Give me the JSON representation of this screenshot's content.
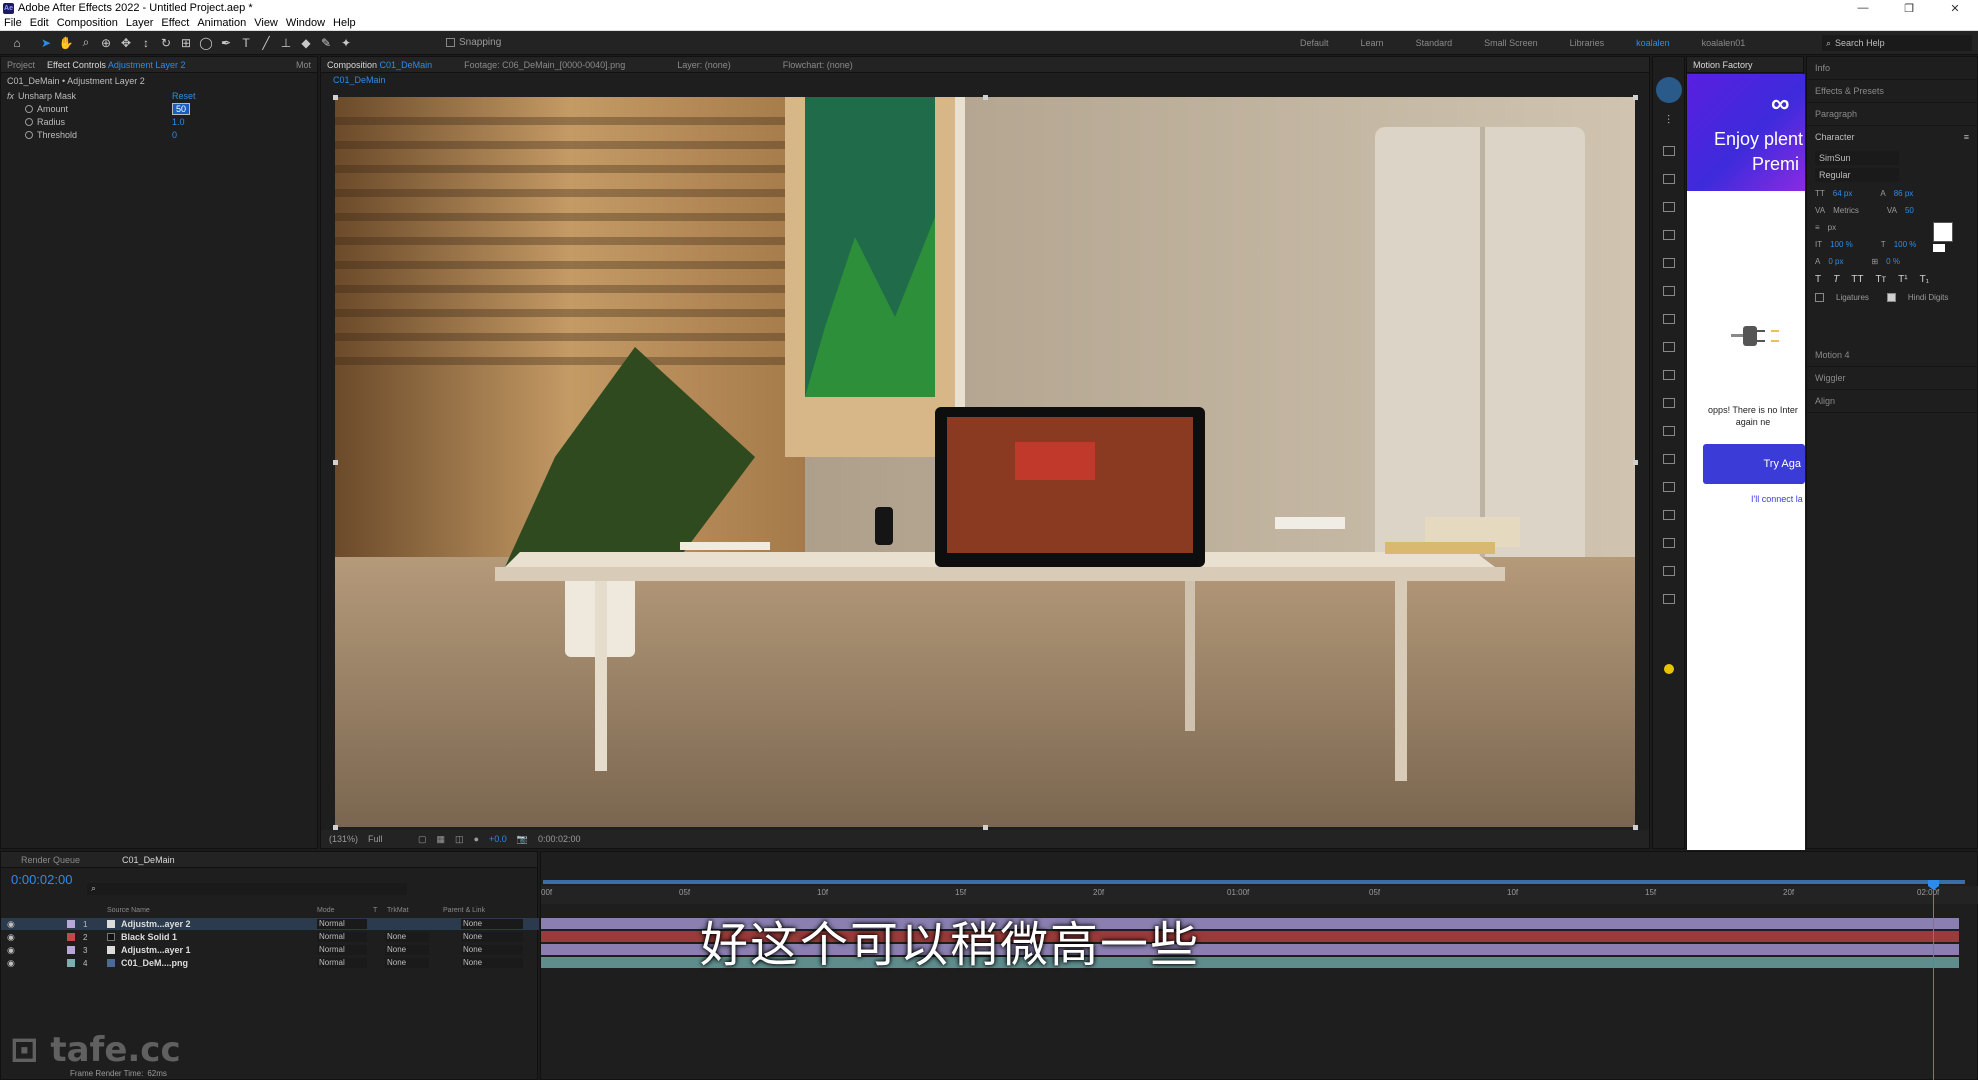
{
  "window": {
    "title": "Adobe After Effects 2022 - Untitled Project.aep *",
    "app_icon": "Ae",
    "controls": [
      "—",
      "❐",
      "✕"
    ]
  },
  "menu": [
    "File",
    "Edit",
    "Composition",
    "Layer",
    "Effect",
    "Animation",
    "View",
    "Window",
    "Help"
  ],
  "toolbar": {
    "snapping": "Snapping",
    "workspaces": [
      "Default",
      "Learn",
      "Standard",
      "Small Screen",
      "Libraries",
      "koalalen",
      "koalalen01"
    ],
    "active_workspace": "koalalen",
    "search_help": "Search Help"
  },
  "effect_controls": {
    "tabs": [
      "Project",
      "Effect Controls",
      "Mot"
    ],
    "active_layer": "Adjustment Layer 2",
    "subtitle": "C01_DeMain • Adjustment Layer 2",
    "effect_name": "Unsharp Mask",
    "reset_label": "Reset",
    "params": [
      {
        "label": "Amount",
        "value": "50"
      },
      {
        "label": "Radius",
        "value": "1.0"
      },
      {
        "label": "Threshold",
        "value": "0"
      }
    ]
  },
  "composition": {
    "tab_label": "Composition",
    "comp_name": "C01_DeMain",
    "footage_tab": "Footage: C06_DeMain_[0000-0040].png",
    "layer_tab": "Layer: (none)",
    "flowchart_tab": "Flowchart: (none)",
    "breadcrumb": "C01_DeMain",
    "zoom": "(131%)",
    "resolution": "Full",
    "exposure": "+0.0",
    "timecode": "0:00:02:00"
  },
  "motion_factory": {
    "tab": "Motion Factory",
    "banner_line1": "Enjoy plent",
    "banner_line2": "Premi",
    "message_line1": "opps! There is no Inter",
    "message_line2": "again ne",
    "button": "Try Aga",
    "link": "I'll connect la"
  },
  "right_panel": {
    "sections_top": [
      "Info",
      "Effects & Presets",
      "Paragraph"
    ],
    "character_title": "Character",
    "font": "SimSun",
    "style": "Regular",
    "size": "64 px",
    "leading": "86 px",
    "tracking": "50",
    "kerning": "Metrics",
    "unit": "px",
    "vscale": "100 %",
    "hscale": "100 %",
    "baseline": "0 px",
    "tsume": "0 %",
    "ligatures": "Ligatures",
    "hindi_digits": "Hindi Digits",
    "sections_bottom": [
      "Motion 4",
      "Wiggler",
      "Align"
    ]
  },
  "timeline": {
    "render_queue_tab": "Render Queue",
    "comp_tab": "C01_DeMain",
    "timecode": "0:00:02:00",
    "columns": [
      "Source Name",
      "Mode",
      "T",
      "TrkMat",
      "Parent & Link"
    ],
    "layers": [
      {
        "num": "1",
        "name": "Adjustm...ayer 2",
        "mode": "Normal",
        "trkmat": "",
        "parent": "None",
        "color": "#b8a8d8"
      },
      {
        "num": "2",
        "name": "Black Solid 1",
        "mode": "Normal",
        "trkmat": "None",
        "parent": "None",
        "color": "#c04a4a"
      },
      {
        "num": "3",
        "name": "Adjustm...ayer 1",
        "mode": "Normal",
        "trkmat": "None",
        "parent": "None",
        "color": "#b8a8d8"
      },
      {
        "num": "4",
        "name": "C01_DeM....png",
        "mode": "Normal",
        "trkmat": "None",
        "parent": "None",
        "color": "#7ab0b0"
      }
    ],
    "ruler_ticks": [
      "00f",
      "05f",
      "10f",
      "15f",
      "20f",
      "01:00f",
      "05f",
      "10f",
      "15f",
      "20f",
      "02:00f"
    ],
    "frame_render_time_label": "Frame Render Time:",
    "frame_render_time": "62ms"
  },
  "overlay": {
    "subtitle": "好这个可以稍微高一些",
    "watermark": "tafe.cc"
  }
}
